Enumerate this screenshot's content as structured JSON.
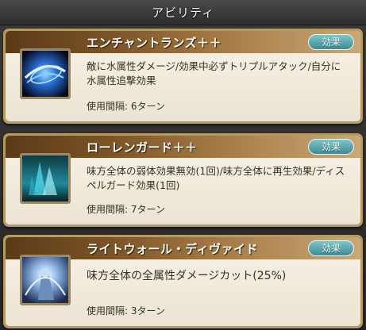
{
  "header": {
    "title": "アビリティ"
  },
  "abilities": [
    {
      "name": "エンチャントランズ＋＋",
      "effect_label": "効果",
      "description": "敵に水属性ダメージ/効果中必ずトリプルアタック/自分に水属性追撃効果",
      "cooldown": "使用間隔: 6ターン",
      "icon": "water-slash-icon"
    },
    {
      "name": "ローレンガード＋＋",
      "effect_label": "効果",
      "description": "味方全体の弱体効果無効(1回)/味方全体に再生効果/ディスペルガード効果(1回)",
      "cooldown": "使用間隔: 7ターン",
      "icon": "water-shield-icon"
    },
    {
      "name": "ライトウォール・ディヴァイド",
      "effect_label": "効果",
      "description": "味方全体の全属性ダメージカット(25%)",
      "cooldown": "使用間隔: 3ターン",
      "icon": "light-wall-icon"
    }
  ]
}
